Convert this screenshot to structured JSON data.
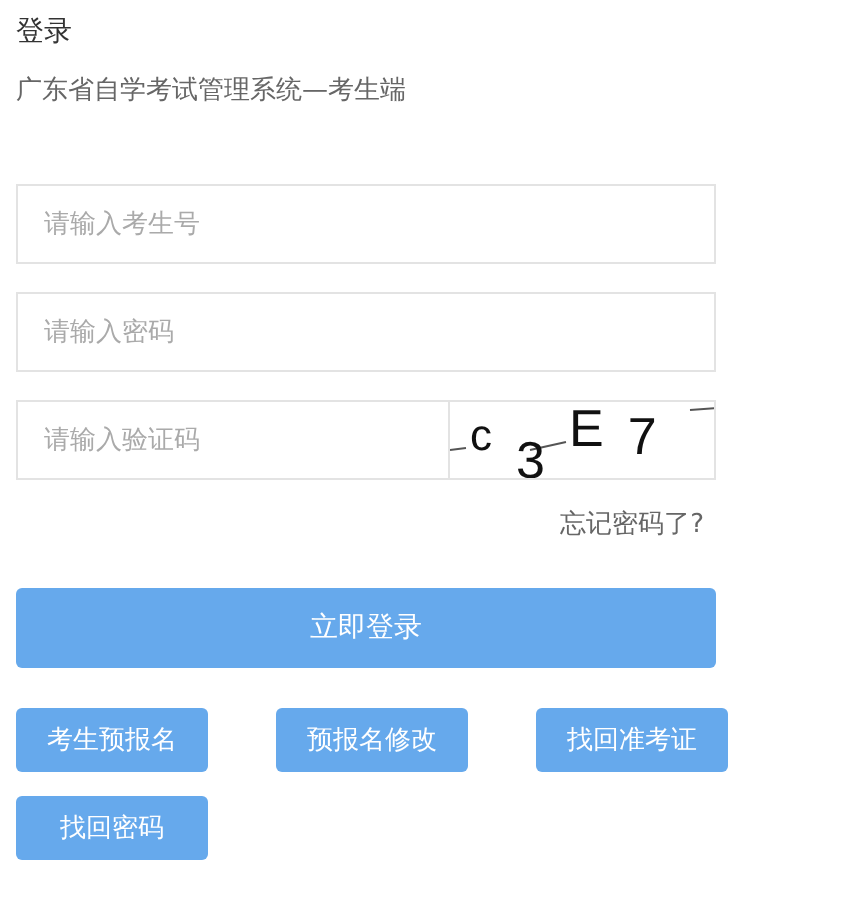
{
  "title": "登录",
  "subtitle": "广东省自学考试管理系统—考生端",
  "fields": [
    {
      "kind": "text",
      "placeholder": "请输入考生号"
    },
    {
      "kind": "text",
      "placeholder": "请输入密码"
    },
    {
      "kind": "captcha",
      "placeholder": "请输入验证码",
      "captcha": [
        "c",
        "3",
        "E",
        "7"
      ]
    }
  ],
  "forgot_link": "忘记密码了?",
  "login_button": "立即登录",
  "buttons": [
    "考生预报名",
    "预报名修改",
    "找回准考证",
    "找回密码"
  ]
}
